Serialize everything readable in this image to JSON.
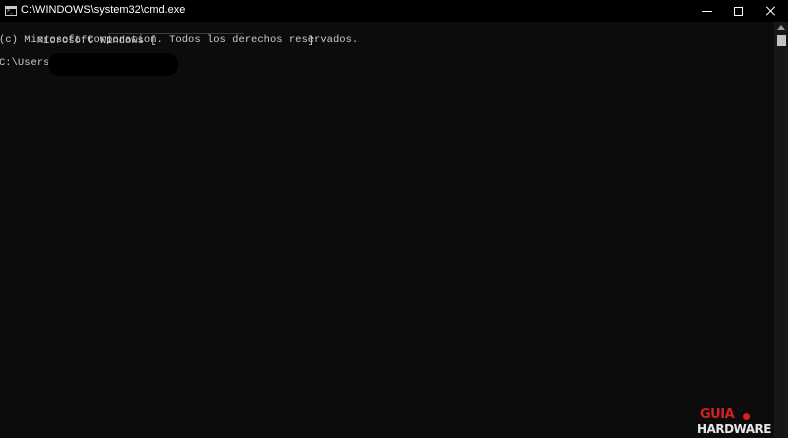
{
  "window": {
    "title": "C:\\WINDOWS\\system32\\cmd.exe",
    "icon": "cmd-console-icon",
    "controls": {
      "minimize": "minimize-icon",
      "maximize": "maximize-icon",
      "close": "close-icon"
    }
  },
  "console": {
    "line1": "Microsoft Windows [                        ]",
    "line2": "(c) Microsoft Corporation. Todos los derechos reservados.",
    "prompt": "C:\\Users\\"
  },
  "watermark": {
    "top": "GUIA",
    "bottom": "HARDWARE",
    "accent_color": "#d62020"
  },
  "colors": {
    "background": "#0c0c0c",
    "text": "#cccccc",
    "titlebar": "#000000"
  }
}
